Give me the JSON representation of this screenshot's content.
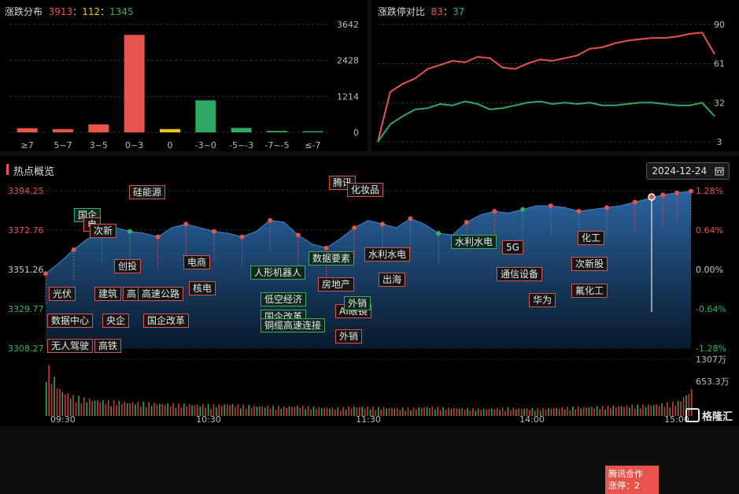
{
  "distribution": {
    "title": "涨跌分布",
    "up": "3913",
    "flat": "112",
    "down": "1345",
    "sep1": "：",
    "sep2": "：",
    "y_ticks": [
      "3642",
      "2428",
      "1214",
      "0"
    ]
  },
  "ratio": {
    "title": "涨跌停对比",
    "limit_up": "83",
    "sep": "：",
    "limit_down": "37",
    "y_ticks": [
      "90",
      "61",
      "32",
      "3"
    ]
  },
  "hot": {
    "title": "热点概览",
    "date": "2024-12-24",
    "left_ticks": [
      "3394.25",
      "3372.76",
      "3351.26",
      "3329.77",
      "3308.27"
    ],
    "right_ticks": [
      "1.28%",
      "0.64%",
      "0.00%",
      "-0.64%",
      "-1.28%"
    ],
    "vol_ticks": [
      "1307万",
      "653.3万"
    ],
    "time_ticks": [
      "09:30",
      "10:30",
      "11:30",
      "14:00",
      "15:00"
    ],
    "tooltip": {
      "line1": "腾讯合作",
      "line2": "涨停：2"
    },
    "tags": [
      {
        "text": "硅能源",
        "type": "r"
      },
      {
        "text": "国企",
        "type": "g"
      },
      {
        "text": "电",
        "type": "r"
      },
      {
        "text": "次新",
        "type": "r"
      },
      {
        "text": "创投",
        "type": "r"
      },
      {
        "text": "电商",
        "type": "r"
      },
      {
        "text": "核电",
        "type": "r"
      },
      {
        "text": "光伏",
        "type": "r"
      },
      {
        "text": "建筑",
        "type": "r"
      },
      {
        "text": "高",
        "type": "r"
      },
      {
        "text": "高速公路",
        "type": "r"
      },
      {
        "text": "数据中心",
        "type": "r"
      },
      {
        "text": "央企",
        "type": "r"
      },
      {
        "text": "国企改革",
        "type": "r"
      },
      {
        "text": "无人驾驶",
        "type": "r"
      },
      {
        "text": "高铁",
        "type": "r"
      },
      {
        "text": "人形机器人",
        "type": "g"
      },
      {
        "text": "低空经济",
        "type": "g"
      },
      {
        "text": "国企改革",
        "type": "g"
      },
      {
        "text": "铜缆高速连接",
        "type": "g"
      },
      {
        "text": "数据要素",
        "type": "g"
      },
      {
        "text": "房地产",
        "type": "r"
      },
      {
        "text": "AI眼镜",
        "type": "r"
      },
      {
        "text": "外销",
        "type": "g"
      },
      {
        "text": "外销",
        "type": "r"
      },
      {
        "text": "腾讯",
        "type": "r"
      },
      {
        "text": "化妆品",
        "type": "r"
      },
      {
        "text": "水利水电",
        "type": "r"
      },
      {
        "text": "出海",
        "type": "r"
      },
      {
        "text": "水利水电",
        "type": "g"
      },
      {
        "text": "5G",
        "type": "r"
      },
      {
        "text": "通信设备",
        "type": "r"
      },
      {
        "text": "华为",
        "type": "r"
      },
      {
        "text": "化工",
        "type": "r"
      },
      {
        "text": "次新股",
        "type": "r"
      },
      {
        "text": "氟化工",
        "type": "r"
      }
    ]
  },
  "watermark": "格隆汇",
  "chart_data": [
    {
      "type": "bar",
      "title": "涨跌分布",
      "categories": [
        "≥7",
        "5~7",
        "3~5",
        "0~3",
        "0",
        "-3~0",
        "-5~-3",
        "-7~-5",
        "≤-7"
      ],
      "values": [
        140,
        110,
        270,
        3290,
        112,
        1080,
        150,
        50,
        40
      ],
      "colors": [
        "#e8544b",
        "#e8544b",
        "#e8544b",
        "#e8544b",
        "#e8c21f",
        "#2ea862",
        "#2ea862",
        "#2ea862",
        "#2ea862"
      ],
      "ylim": [
        0,
        3642
      ]
    },
    {
      "type": "line",
      "title": "涨跌停对比",
      "ylim": [
        3,
        90
      ],
      "series": [
        {
          "color": "#e8544b",
          "values": [
            3,
            40,
            46,
            50,
            57,
            60,
            63,
            62,
            66,
            65,
            58,
            57,
            61,
            64,
            63,
            65,
            67,
            72,
            73,
            76,
            78,
            79,
            80,
            80,
            81,
            83,
            84,
            68
          ]
        },
        {
          "color": "#2ea862",
          "values": [
            3,
            16,
            22,
            27,
            28,
            31,
            30,
            33,
            31,
            27,
            28,
            30,
            32,
            33,
            31,
            32,
            31,
            32,
            30,
            30,
            31,
            32,
            32,
            31,
            30,
            30,
            32,
            22
          ]
        }
      ]
    },
    {
      "type": "area",
      "title": "热点概览",
      "ylim": [
        3308.27,
        3394.25
      ],
      "x": [
        "09:30",
        "10:30",
        "11:30",
        "14:00",
        "15:00"
      ],
      "series": [
        {
          "name": "index",
          "values": [
            3349,
            3355,
            3362,
            3368,
            3370,
            3374,
            3372,
            3371,
            3369,
            3374,
            3376,
            3374,
            3372,
            3371,
            3369,
            3372,
            3378,
            3377,
            3370,
            3365,
            3363,
            3368,
            3374,
            3378,
            3376,
            3374,
            3379,
            3376,
            3371,
            3370,
            3377,
            3381,
            3383,
            3382,
            3384,
            3386,
            3386,
            3385,
            3383,
            3384,
            3385,
            3386,
            3388,
            3390,
            3392,
            3393,
            3394
          ]
        },
        {
          "name": "volume",
          "values": [
            1307,
            650,
            480,
            420,
            380,
            360,
            340,
            330,
            310,
            300,
            290,
            280,
            270,
            300,
            260,
            250,
            240,
            230,
            250,
            220,
            210,
            200,
            240,
            220,
            210,
            200,
            190,
            230,
            210,
            200,
            190,
            180,
            190,
            200,
            190,
            180,
            200,
            210,
            220,
            230,
            240,
            250,
            260,
            280,
            300,
            350,
            653
          ]
        }
      ]
    }
  ]
}
